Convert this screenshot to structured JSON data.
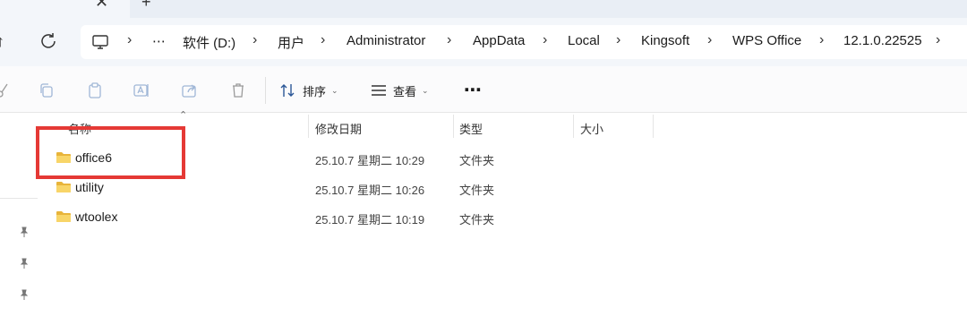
{
  "tabstrip": {
    "close_glyph": "✕",
    "new_tab_glyph": "+"
  },
  "navigation": {
    "up_icon": "arrow-up-icon",
    "refresh_icon": "refresh-icon"
  },
  "address": {
    "root_icon": "pc-icon",
    "overflow": "⋯",
    "crumbs": [
      "软件 (D:)",
      "用户",
      "Administrator",
      "AppData",
      "Local",
      "Kingsoft",
      "WPS Office",
      "12.1.0.22525"
    ],
    "separator": "›"
  },
  "toolbar": {
    "icons": [
      "cut-icon",
      "copy-icon",
      "paste-icon",
      "rename-icon",
      "share-icon",
      "delete-icon"
    ],
    "sort_label": "排序",
    "view_label": "查看",
    "more_label": "⋯"
  },
  "columns": {
    "name": "名称",
    "modified": "修改日期",
    "type": "类型",
    "size": "大小"
  },
  "files": [
    {
      "name": "office6",
      "modified": "25.10.7 星期二 10:29",
      "type": "文件夹"
    },
    {
      "name": "utility",
      "modified": "25.10.7 星期二 10:26",
      "type": "文件夹"
    },
    {
      "name": "wtoolex",
      "modified": "25.10.7 星期二 10:19",
      "type": "文件夹"
    }
  ],
  "colors": {
    "highlight": "#e53935",
    "folder": "#f4c542"
  }
}
